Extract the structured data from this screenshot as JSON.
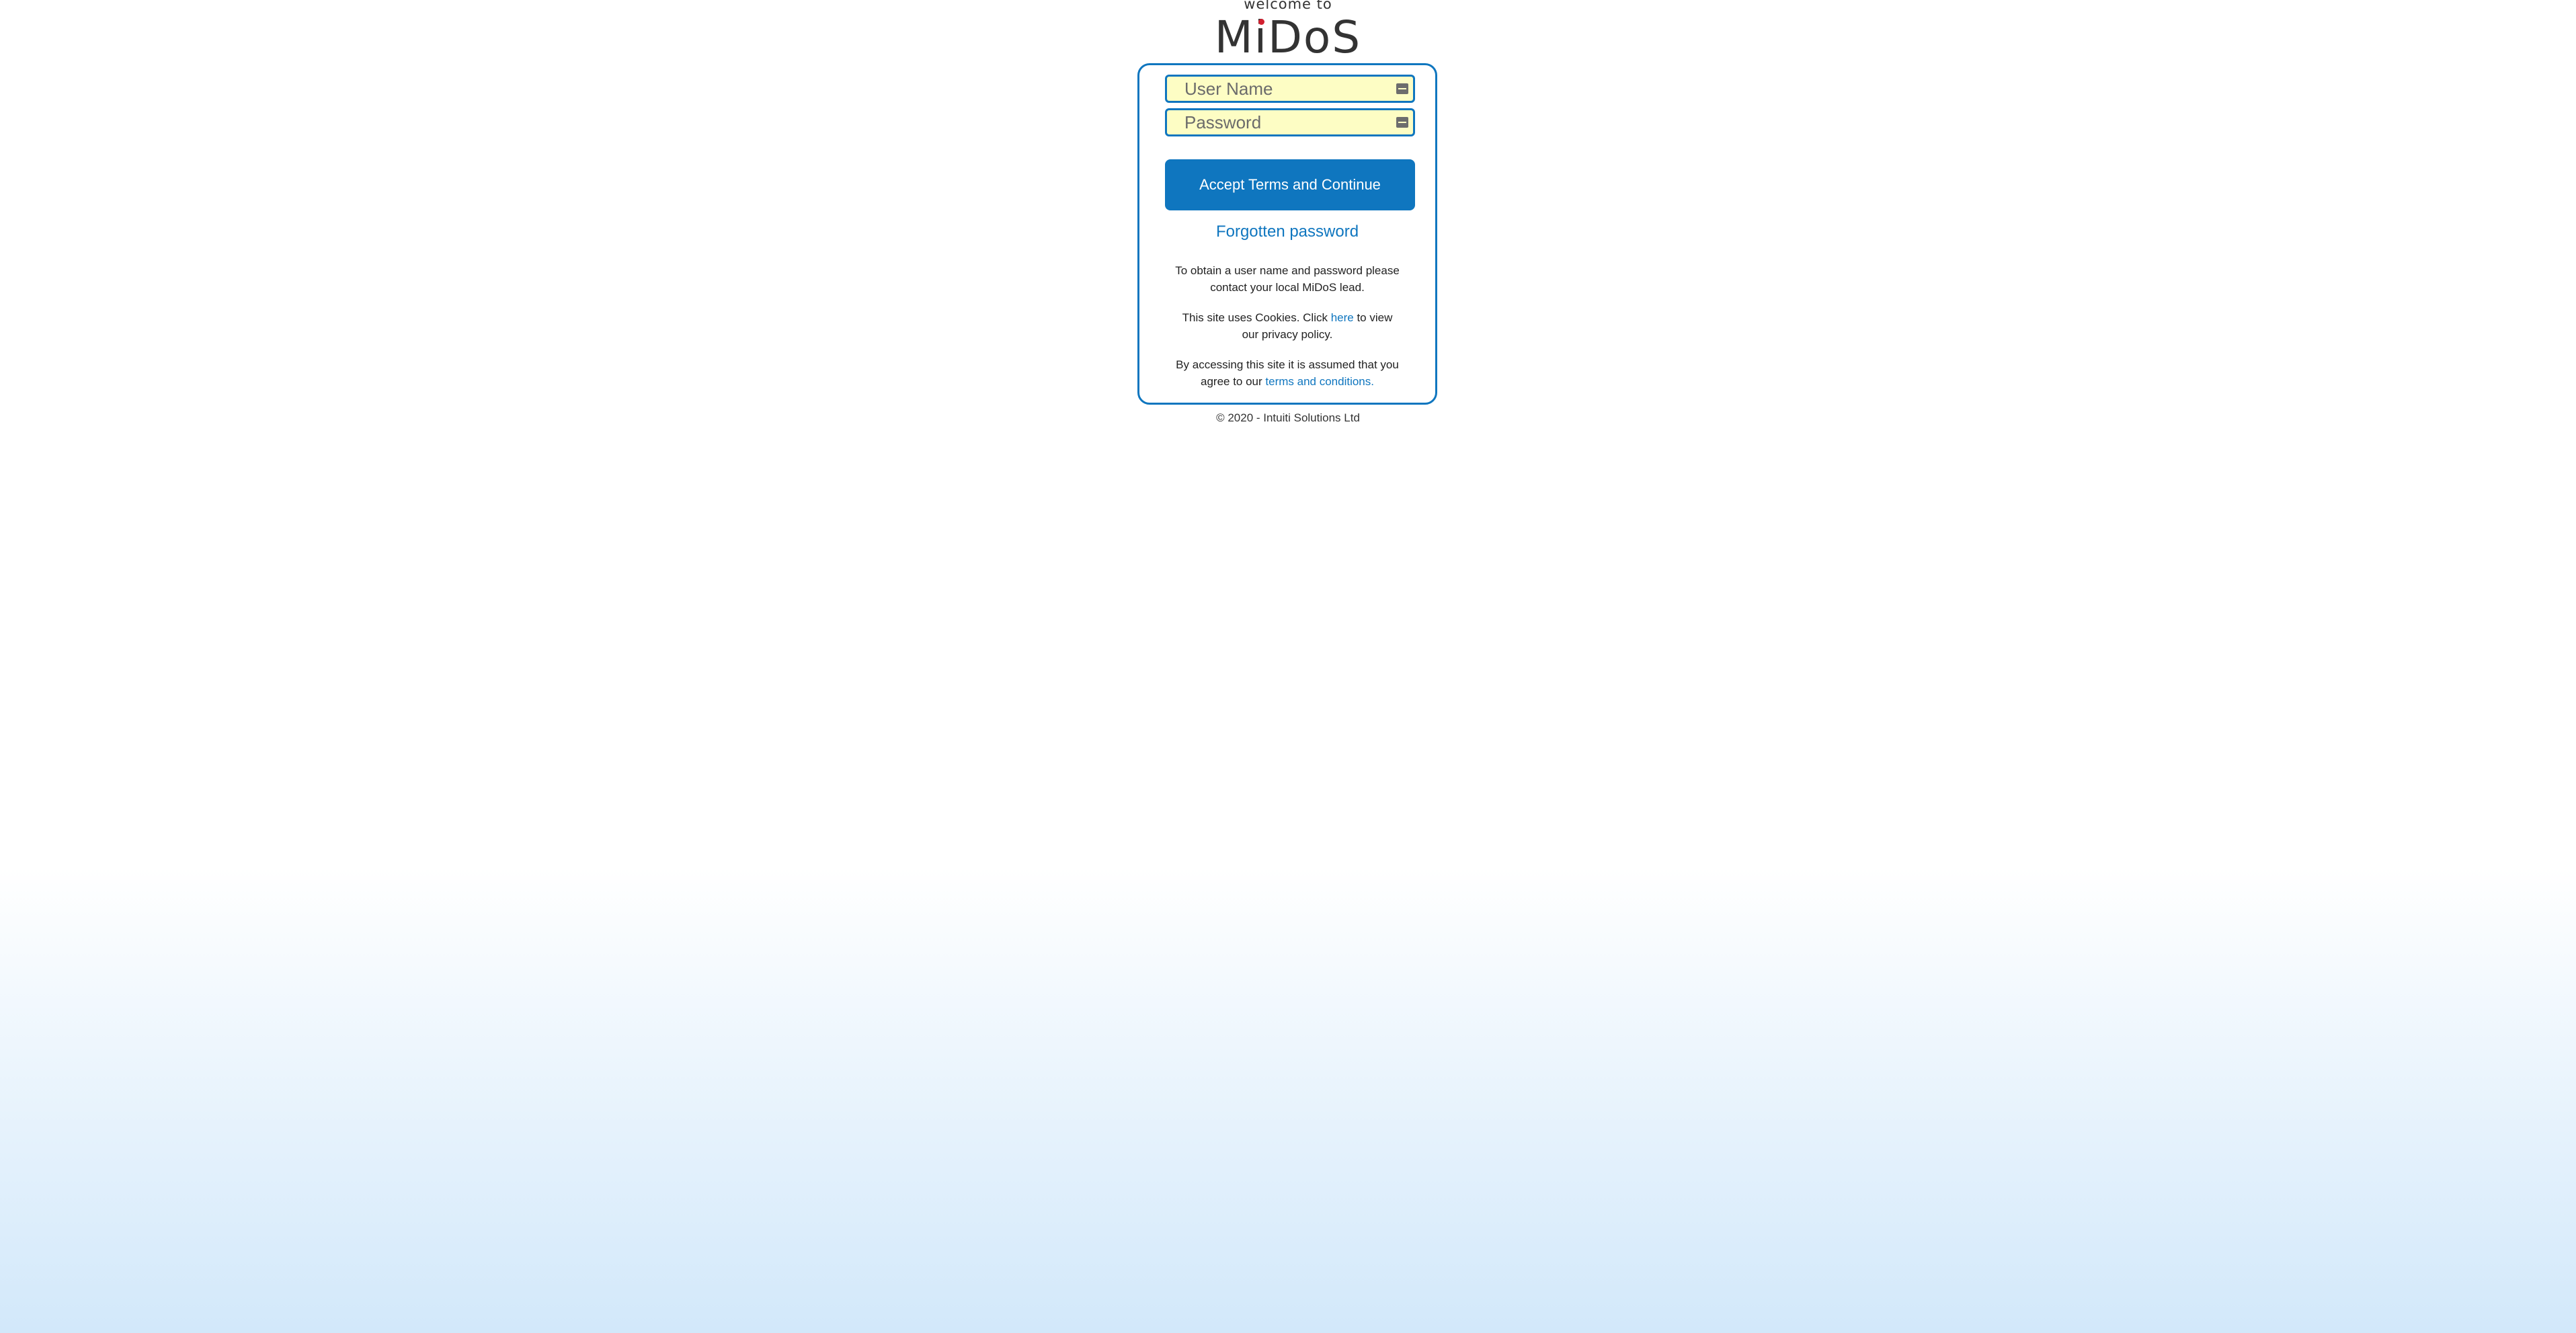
{
  "header": {
    "welcome": "welcome to",
    "logo_pre": "M",
    "logo_i": "i",
    "logo_post": "DoS"
  },
  "login": {
    "username_placeholder": "User Name",
    "password_placeholder": "Password",
    "submit_label": "Accept Terms and Continue",
    "forgot_label": "Forgotten password"
  },
  "info": {
    "obtain_text": "To obtain a user name and password please contact your local MiDoS lead.",
    "cookies_pre": "This site uses Cookies. Click ",
    "cookies_link": "here",
    "cookies_post": " to view our privacy policy.",
    "terms_pre": "By accessing this site it is assumed that you agree to our ",
    "terms_link": "terms and conditions."
  },
  "footer": {
    "copyright": "© 2020 - Intuiti Solutions Ltd"
  },
  "colors": {
    "accent": "#0f76bf",
    "input_bg": "#fdfdc4",
    "logo_dot": "#d2202f",
    "gradient_bottom": "#d2e8fa"
  },
  "icons": {
    "field_icon": "key-icon"
  }
}
